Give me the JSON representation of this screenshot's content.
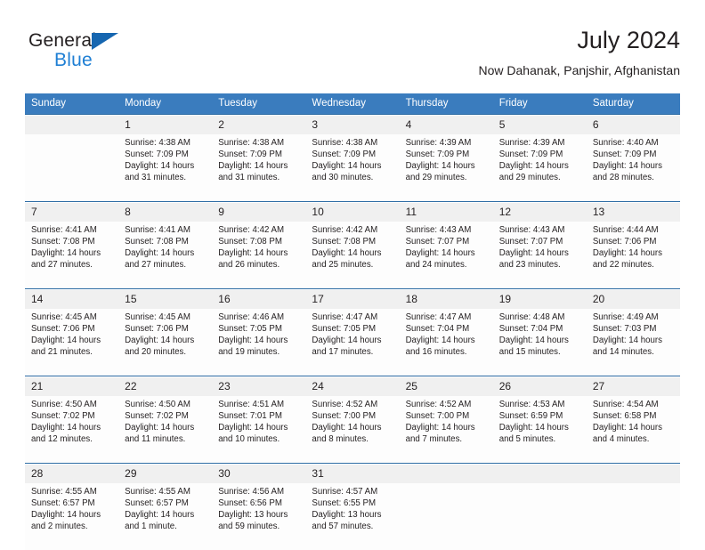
{
  "brand": {
    "word_one": "General",
    "word_two": "Blue",
    "triangle_color": "#1666b0",
    "blue_text_color": "#1f7fd4"
  },
  "header": {
    "title": "July 2024",
    "subtitle": "Now Dahanak, Panjshir, Afghanistan"
  },
  "theme": {
    "header_band": "#3a7cbe",
    "week_separator": "#2e6ca4",
    "daynum_band": "#f0f0f0",
    "cell_bg": "#fdfdfd",
    "text": "#231f20"
  },
  "weekday_headers": [
    "Sunday",
    "Monday",
    "Tuesday",
    "Wednesday",
    "Thursday",
    "Friday",
    "Saturday"
  ],
  "labels": {
    "sunrise_prefix": "Sunrise:",
    "sunset_prefix": "Sunset:",
    "daylight_prefix": "Daylight:"
  },
  "weeks": [
    {
      "days": [
        {
          "num": "",
          "sunrise": "",
          "sunset": "",
          "daylight_line1": "",
          "daylight_line2": ""
        },
        {
          "num": "1",
          "sunrise": "Sunrise: 4:38 AM",
          "sunset": "Sunset: 7:09 PM",
          "daylight_line1": "Daylight: 14 hours",
          "daylight_line2": "and 31 minutes."
        },
        {
          "num": "2",
          "sunrise": "Sunrise: 4:38 AM",
          "sunset": "Sunset: 7:09 PM",
          "daylight_line1": "Daylight: 14 hours",
          "daylight_line2": "and 31 minutes."
        },
        {
          "num": "3",
          "sunrise": "Sunrise: 4:38 AM",
          "sunset": "Sunset: 7:09 PM",
          "daylight_line1": "Daylight: 14 hours",
          "daylight_line2": "and 30 minutes."
        },
        {
          "num": "4",
          "sunrise": "Sunrise: 4:39 AM",
          "sunset": "Sunset: 7:09 PM",
          "daylight_line1": "Daylight: 14 hours",
          "daylight_line2": "and 29 minutes."
        },
        {
          "num": "5",
          "sunrise": "Sunrise: 4:39 AM",
          "sunset": "Sunset: 7:09 PM",
          "daylight_line1": "Daylight: 14 hours",
          "daylight_line2": "and 29 minutes."
        },
        {
          "num": "6",
          "sunrise": "Sunrise: 4:40 AM",
          "sunset": "Sunset: 7:09 PM",
          "daylight_line1": "Daylight: 14 hours",
          "daylight_line2": "and 28 minutes."
        }
      ]
    },
    {
      "days": [
        {
          "num": "7",
          "sunrise": "Sunrise: 4:41 AM",
          "sunset": "Sunset: 7:08 PM",
          "daylight_line1": "Daylight: 14 hours",
          "daylight_line2": "and 27 minutes."
        },
        {
          "num": "8",
          "sunrise": "Sunrise: 4:41 AM",
          "sunset": "Sunset: 7:08 PM",
          "daylight_line1": "Daylight: 14 hours",
          "daylight_line2": "and 27 minutes."
        },
        {
          "num": "9",
          "sunrise": "Sunrise: 4:42 AM",
          "sunset": "Sunset: 7:08 PM",
          "daylight_line1": "Daylight: 14 hours",
          "daylight_line2": "and 26 minutes."
        },
        {
          "num": "10",
          "sunrise": "Sunrise: 4:42 AM",
          "sunset": "Sunset: 7:08 PM",
          "daylight_line1": "Daylight: 14 hours",
          "daylight_line2": "and 25 minutes."
        },
        {
          "num": "11",
          "sunrise": "Sunrise: 4:43 AM",
          "sunset": "Sunset: 7:07 PM",
          "daylight_line1": "Daylight: 14 hours",
          "daylight_line2": "and 24 minutes."
        },
        {
          "num": "12",
          "sunrise": "Sunrise: 4:43 AM",
          "sunset": "Sunset: 7:07 PM",
          "daylight_line1": "Daylight: 14 hours",
          "daylight_line2": "and 23 minutes."
        },
        {
          "num": "13",
          "sunrise": "Sunrise: 4:44 AM",
          "sunset": "Sunset: 7:06 PM",
          "daylight_line1": "Daylight: 14 hours",
          "daylight_line2": "and 22 minutes."
        }
      ]
    },
    {
      "days": [
        {
          "num": "14",
          "sunrise": "Sunrise: 4:45 AM",
          "sunset": "Sunset: 7:06 PM",
          "daylight_line1": "Daylight: 14 hours",
          "daylight_line2": "and 21 minutes."
        },
        {
          "num": "15",
          "sunrise": "Sunrise: 4:45 AM",
          "sunset": "Sunset: 7:06 PM",
          "daylight_line1": "Daylight: 14 hours",
          "daylight_line2": "and 20 minutes."
        },
        {
          "num": "16",
          "sunrise": "Sunrise: 4:46 AM",
          "sunset": "Sunset: 7:05 PM",
          "daylight_line1": "Daylight: 14 hours",
          "daylight_line2": "and 19 minutes."
        },
        {
          "num": "17",
          "sunrise": "Sunrise: 4:47 AM",
          "sunset": "Sunset: 7:05 PM",
          "daylight_line1": "Daylight: 14 hours",
          "daylight_line2": "and 17 minutes."
        },
        {
          "num": "18",
          "sunrise": "Sunrise: 4:47 AM",
          "sunset": "Sunset: 7:04 PM",
          "daylight_line1": "Daylight: 14 hours",
          "daylight_line2": "and 16 minutes."
        },
        {
          "num": "19",
          "sunrise": "Sunrise: 4:48 AM",
          "sunset": "Sunset: 7:04 PM",
          "daylight_line1": "Daylight: 14 hours",
          "daylight_line2": "and 15 minutes."
        },
        {
          "num": "20",
          "sunrise": "Sunrise: 4:49 AM",
          "sunset": "Sunset: 7:03 PM",
          "daylight_line1": "Daylight: 14 hours",
          "daylight_line2": "and 14 minutes."
        }
      ]
    },
    {
      "days": [
        {
          "num": "21",
          "sunrise": "Sunrise: 4:50 AM",
          "sunset": "Sunset: 7:02 PM",
          "daylight_line1": "Daylight: 14 hours",
          "daylight_line2": "and 12 minutes."
        },
        {
          "num": "22",
          "sunrise": "Sunrise: 4:50 AM",
          "sunset": "Sunset: 7:02 PM",
          "daylight_line1": "Daylight: 14 hours",
          "daylight_line2": "and 11 minutes."
        },
        {
          "num": "23",
          "sunrise": "Sunrise: 4:51 AM",
          "sunset": "Sunset: 7:01 PM",
          "daylight_line1": "Daylight: 14 hours",
          "daylight_line2": "and 10 minutes."
        },
        {
          "num": "24",
          "sunrise": "Sunrise: 4:52 AM",
          "sunset": "Sunset: 7:00 PM",
          "daylight_line1": "Daylight: 14 hours",
          "daylight_line2": "and 8 minutes."
        },
        {
          "num": "25",
          "sunrise": "Sunrise: 4:52 AM",
          "sunset": "Sunset: 7:00 PM",
          "daylight_line1": "Daylight: 14 hours",
          "daylight_line2": "and 7 minutes."
        },
        {
          "num": "26",
          "sunrise": "Sunrise: 4:53 AM",
          "sunset": "Sunset: 6:59 PM",
          "daylight_line1": "Daylight: 14 hours",
          "daylight_line2": "and 5 minutes."
        },
        {
          "num": "27",
          "sunrise": "Sunrise: 4:54 AM",
          "sunset": "Sunset: 6:58 PM",
          "daylight_line1": "Daylight: 14 hours",
          "daylight_line2": "and 4 minutes."
        }
      ]
    },
    {
      "days": [
        {
          "num": "28",
          "sunrise": "Sunrise: 4:55 AM",
          "sunset": "Sunset: 6:57 PM",
          "daylight_line1": "Daylight: 14 hours",
          "daylight_line2": "and 2 minutes."
        },
        {
          "num": "29",
          "sunrise": "Sunrise: 4:55 AM",
          "sunset": "Sunset: 6:57 PM",
          "daylight_line1": "Daylight: 14 hours",
          "daylight_line2": "and 1 minute."
        },
        {
          "num": "30",
          "sunrise": "Sunrise: 4:56 AM",
          "sunset": "Sunset: 6:56 PM",
          "daylight_line1": "Daylight: 13 hours",
          "daylight_line2": "and 59 minutes."
        },
        {
          "num": "31",
          "sunrise": "Sunrise: 4:57 AM",
          "sunset": "Sunset: 6:55 PM",
          "daylight_line1": "Daylight: 13 hours",
          "daylight_line2": "and 57 minutes."
        },
        {
          "num": "",
          "sunrise": "",
          "sunset": "",
          "daylight_line1": "",
          "daylight_line2": ""
        },
        {
          "num": "",
          "sunrise": "",
          "sunset": "",
          "daylight_line1": "",
          "daylight_line2": ""
        },
        {
          "num": "",
          "sunrise": "",
          "sunset": "",
          "daylight_line1": "",
          "daylight_line2": ""
        }
      ]
    }
  ]
}
